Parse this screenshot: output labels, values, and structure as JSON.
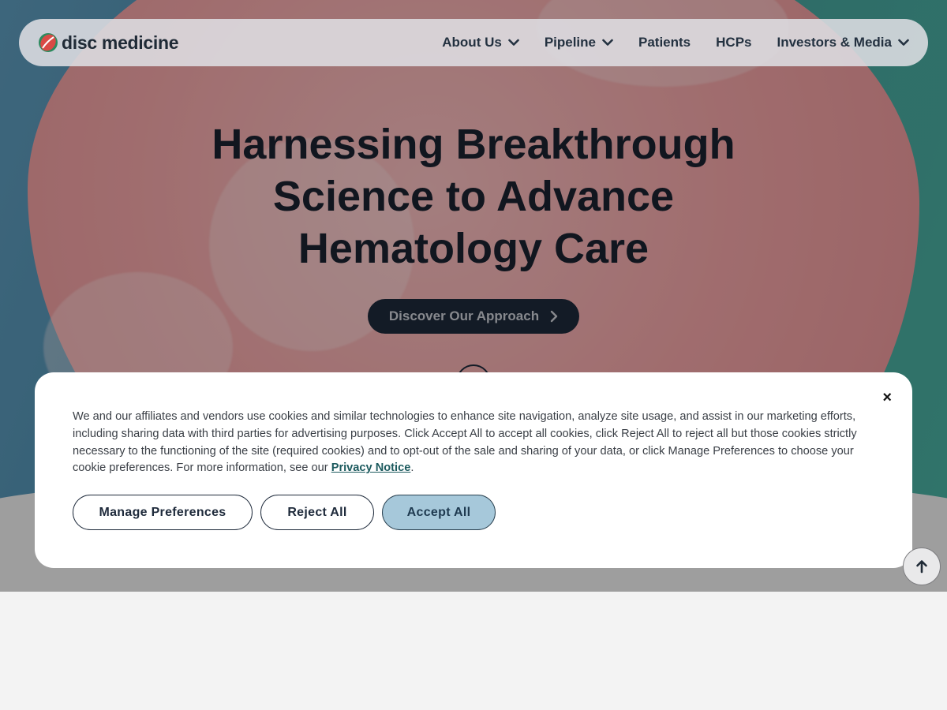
{
  "brand": {
    "name": "disc medicine"
  },
  "nav": {
    "items": [
      {
        "label": "About Us",
        "dropdown": true
      },
      {
        "label": "Pipeline",
        "dropdown": true
      },
      {
        "label": "Patients",
        "dropdown": false
      },
      {
        "label": "HCPs",
        "dropdown": false
      },
      {
        "label": "Investors & Media",
        "dropdown": true
      }
    ]
  },
  "hero": {
    "title_lines": [
      "Harnessing Breakthrough",
      "Science to Advance",
      "Hematology Care"
    ],
    "cta_label": "Discover Our Approach"
  },
  "cookie_banner": {
    "text": "We and our affiliates and vendors use cookies and similar technologies to enhance site navigation, analyze site usage, and assist in our marketing efforts, including sharing data with third parties for advertising purposes. Click Accept All to accept all cookies, click Reject All to reject all but those cookies strictly necessary to the functioning of the site (required cookies) and to opt-out of the sale and sharing of your data, or click Manage Preferences to choose your cookie preferences. For more information, see our",
    "link_label": "Privacy Notice",
    "text_end": ".",
    "close_label": "×",
    "buttons": {
      "manage": "Manage Preferences",
      "reject": "Reject All",
      "accept": "Accept All"
    }
  },
  "colors": {
    "navy": "#1e2a3b",
    "accept_bg": "#a6c8da",
    "blob_pink": "#f6a8aa",
    "teal": "#4ab3a3"
  },
  "icons": [
    "logo-mark-icon",
    "chevron-down-icon",
    "chevron-right-icon",
    "close-icon",
    "arrow-up-icon"
  ]
}
